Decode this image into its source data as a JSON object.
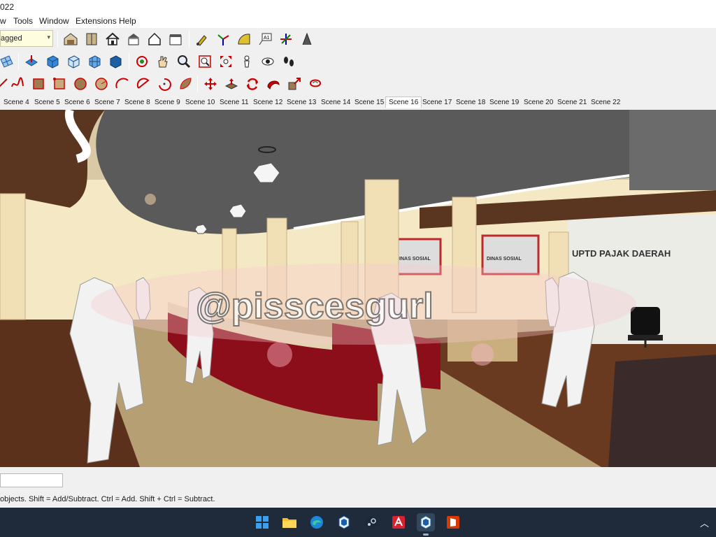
{
  "window": {
    "title_fragment": "022"
  },
  "menu": [
    {
      "label": "w"
    },
    {
      "label": "Tools"
    },
    {
      "label": "Window"
    },
    {
      "label": "Extensions"
    },
    {
      "label": "Help"
    }
  ],
  "tag_dropdown": {
    "value": "agged"
  },
  "scenes": [
    {
      "label": "Scene 4"
    },
    {
      "label": "Scene 5"
    },
    {
      "label": "Scene 6"
    },
    {
      "label": "Scene 7"
    },
    {
      "label": "Scene 8"
    },
    {
      "label": "Scene 9"
    },
    {
      "label": "Scene 10"
    },
    {
      "label": "Scene 11"
    },
    {
      "label": "Scene 12"
    },
    {
      "label": "Scene 13"
    },
    {
      "label": "Scene 14"
    },
    {
      "label": "Scene 15"
    },
    {
      "label": "Scene 16"
    },
    {
      "label": "Scene 17"
    },
    {
      "label": "Scene 18"
    },
    {
      "label": "Scene 19"
    },
    {
      "label": "Scene 20"
    },
    {
      "label": "Scene 21"
    },
    {
      "label": "Scene 22"
    }
  ],
  "active_scene": "Scene 16",
  "scene_signage": {
    "main": "UPTD PAJAK DAERAH",
    "left_sign": "DINAS SOSIAL",
    "mid_sign": "DINAS SOSIAL"
  },
  "watermark": "@pisscesgurl",
  "status": {
    "hint": "objects. Shift = Add/Subtract. Ctrl = Add. Shift + Ctrl = Subtract."
  },
  "colors": {
    "accent_red": "#c0282a",
    "ceiling": "#5a5a5a",
    "wall": "#f4e9c4",
    "floor_wood": "#6a3a20",
    "taskbar": "#1f2b3a"
  },
  "toolbar_row1": [
    "warehouse-icon",
    "component-icon",
    "home-icon",
    "house-open-icon",
    "house-outline-icon",
    "storefront-icon",
    "paint-icon",
    "axes-icon",
    "protractor-icon",
    "text-label-icon",
    "axis-arrows-icon",
    "dimension-icon"
  ],
  "toolbar_row2": [
    "grid-icon",
    "push-pull-icon",
    "box-blue-icon",
    "box-open-icon",
    "box-grid-icon",
    "box-solid-icon",
    "orbit-icon",
    "pan-icon",
    "zoom-icon",
    "zoom-window-icon",
    "zoom-extents-icon",
    "position-camera-icon",
    "look-around-icon",
    "walk-icon"
  ],
  "toolbar_row3": [
    "line-icon",
    "freehand-icon",
    "rectangle-icon",
    "rotated-rect-icon",
    "circle-icon",
    "polygon-icon",
    "arc-icon",
    "pie-icon",
    "arc-3pt-icon",
    "leaf-icon",
    "move-icon",
    "push-pull-red-icon",
    "rotate-icon",
    "follow-me-icon",
    "scale-icon",
    "offset-icon"
  ],
  "taskbar": [
    "windows-start-icon",
    "file-explorer-icon",
    "edge-browser-icon",
    "sketchup-icon",
    "steam-icon",
    "autocad-icon",
    "sketchup-active-icon",
    "office-icon"
  ]
}
